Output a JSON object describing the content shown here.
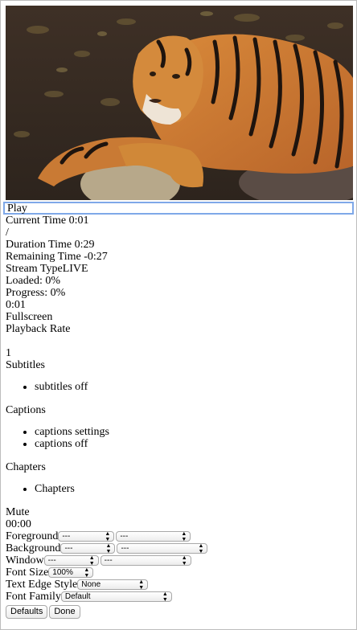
{
  "video": {
    "alt": "tiger"
  },
  "controls": {
    "play": "Play",
    "current_time": "Current Time 0:01",
    "divider": "/",
    "duration": "Duration Time 0:29",
    "remaining": "Remaining Time -0:27",
    "stream_type": "Stream TypeLIVE",
    "loaded": "Loaded: 0%",
    "progress": "Progress: 0%",
    "progress_time": "0:01",
    "fullscreen": "Fullscreen",
    "playback_rate": "Playback Rate",
    "rate_value": "1",
    "subtitles": "Subtitles",
    "subtitles_items": [
      "subtitles off"
    ],
    "captions": "Captions",
    "captions_items": [
      "captions settings",
      "captions off"
    ],
    "chapters": "Chapters",
    "chapters_items": [
      "Chapters"
    ],
    "mute": "Mute",
    "volume": "00:00"
  },
  "caption_settings": {
    "foreground_label": "Foreground",
    "foreground_color": "---",
    "foreground_opacity": "---",
    "background_label": "Background",
    "background_color": "---",
    "background_opacity": "---",
    "window_label": "Window",
    "window_color": "---",
    "window_opacity": "---",
    "font_size_label": "Font Size",
    "font_size": "100%",
    "edge_style_label": "Text Edge Style",
    "edge_style": "None",
    "font_family_label": "Font Family",
    "font_family": "Default",
    "defaults_button": "Defaults",
    "done_button": "Done"
  }
}
